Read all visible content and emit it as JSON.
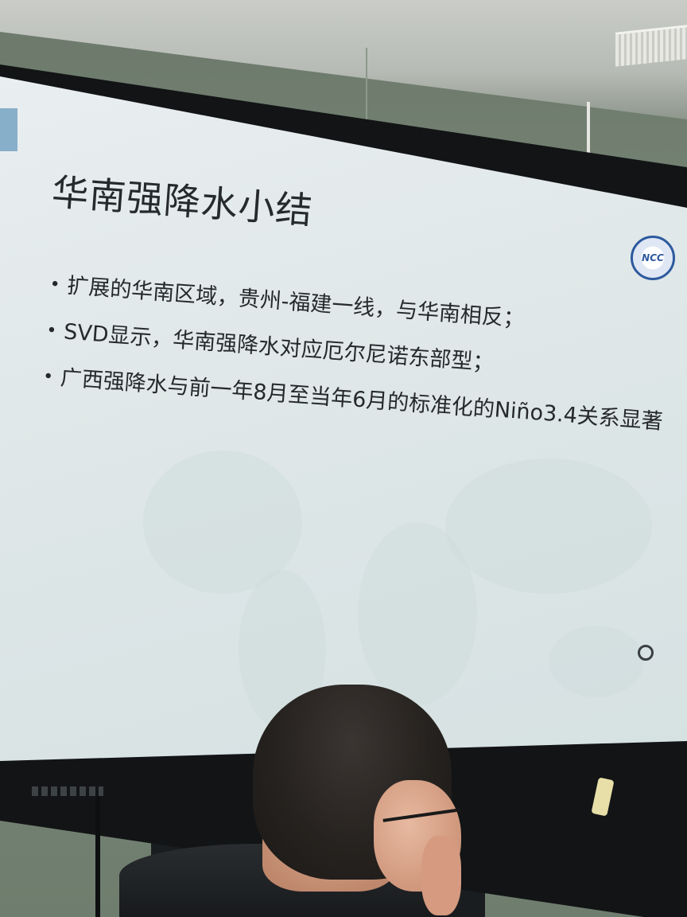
{
  "slide": {
    "title": "华南强降水小结",
    "bullets": [
      "扩展的华南区域，贵州-福建一线，与华南相反；",
      "SVD显示，华南强降水对应厄尔尼诺东部型；",
      "广西强降水与前一年8月至当年6月的标准化的Niño3.4关系显著"
    ],
    "bullet_symbol": "•",
    "logo_text": "NCC",
    "logo_icon": "ncc-globe-emblem-icon",
    "nav_icon": "presentation-nav-ring-icon"
  },
  "colors": {
    "slide_background": "#e3eaeb",
    "text": "#25292b",
    "logo_blue": "#2d5a9e",
    "accent": "#6f9fc1"
  }
}
